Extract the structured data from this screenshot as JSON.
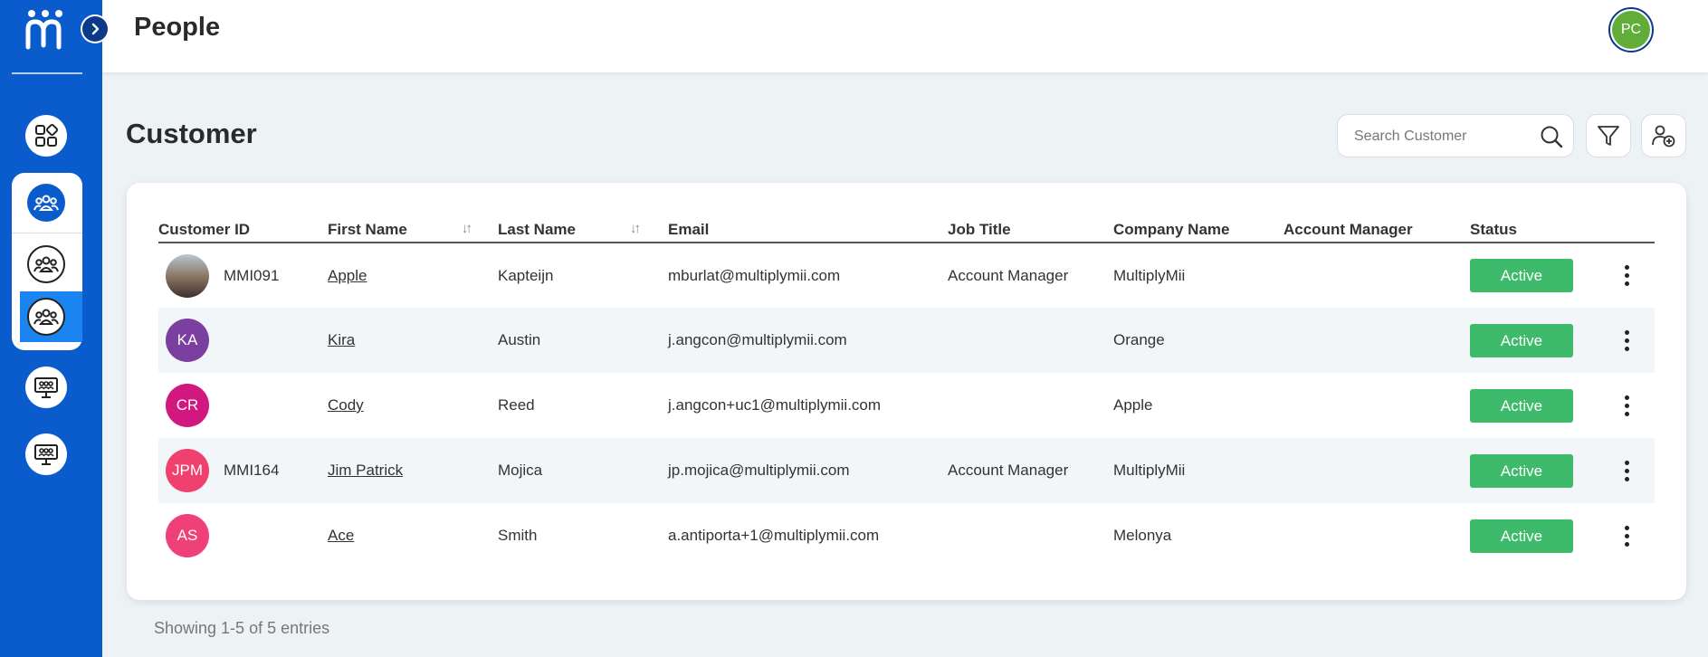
{
  "header": {
    "title": "People",
    "user_initials": "PC"
  },
  "sidebar": {
    "items": [
      {
        "name": "dashboard",
        "icon": "grid-icon"
      },
      {
        "name": "people",
        "icon": "people-group-icon"
      },
      {
        "name": "people-sub-1",
        "icon": "people-group-icon"
      },
      {
        "name": "people-sub-2",
        "icon": "people-group-icon"
      },
      {
        "name": "training",
        "icon": "presentation-board-icon"
      },
      {
        "name": "training-2",
        "icon": "presentation-board-icon"
      }
    ]
  },
  "main": {
    "section_title": "Customer",
    "search": {
      "placeholder": "Search Customer"
    }
  },
  "table": {
    "columns": [
      "Customer ID",
      "First Name",
      "Last Name",
      "Email",
      "Job Title",
      "Company Name",
      "Account Manager",
      "Status"
    ],
    "rows": [
      {
        "initials": "",
        "avatar_color": "",
        "customer_id": "MMI091",
        "first_name": "Apple",
        "last_name": "Kapteijn",
        "email": "mburlat@multiplymii.com",
        "job_title": "Account Manager",
        "company": "MultiplyMii",
        "account_manager": "",
        "status": "Active"
      },
      {
        "initials": "KA",
        "avatar_color": "#7b3fa0",
        "customer_id": "",
        "first_name": "Kira",
        "last_name": "Austin",
        "email": "j.angcon@multiplymii.com",
        "job_title": "",
        "company": "Orange",
        "account_manager": "",
        "status": "Active"
      },
      {
        "initials": "CR",
        "avatar_color": "#d2187f",
        "customer_id": "",
        "first_name": "Cody",
        "last_name": "Reed",
        "email": "j.angcon+uc1@multiplymii.com",
        "job_title": "",
        "company": "Apple",
        "account_manager": "",
        "status": "Active"
      },
      {
        "initials": "JPM",
        "avatar_color": "#f0406e",
        "customer_id": "MMI164",
        "first_name": "Jim Patrick",
        "last_name": "Mojica",
        "email": "jp.mojica@multiplymii.com",
        "job_title": "Account Manager",
        "company": "MultiplyMii",
        "account_manager": "",
        "status": "Active"
      },
      {
        "initials": "AS",
        "avatar_color": "#f0407a",
        "customer_id": "",
        "first_name": "Ace",
        "last_name": "Smith",
        "email": "a.antiporta+1@multiplymii.com",
        "job_title": "",
        "company": "Melonya",
        "account_manager": "",
        "status": "Active"
      }
    ]
  },
  "footer": {
    "entries_text": "Showing 1-5 of 5 entries"
  },
  "colors": {
    "sidebar": "#0a5ccc",
    "status_active": "#3dbb6b",
    "user_avatar": "#62ad3a"
  }
}
